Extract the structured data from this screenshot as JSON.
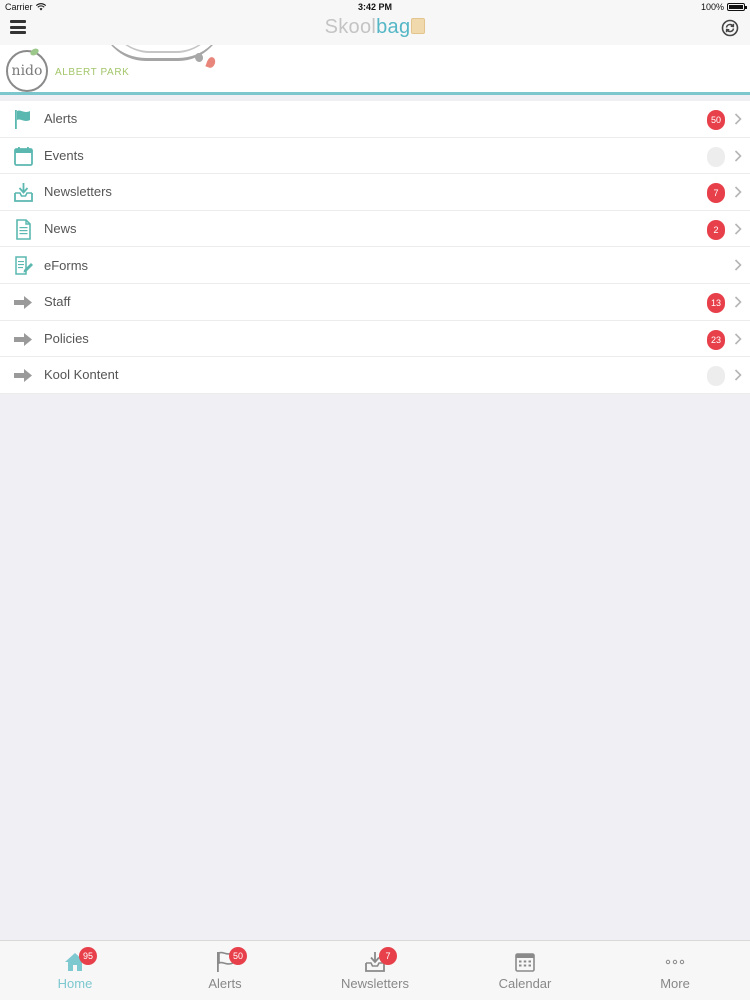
{
  "status_bar": {
    "carrier": "Carrier",
    "time": "3:42 PM",
    "battery": "100%"
  },
  "nav": {
    "brand_part1": "Skool",
    "brand_part2": "bag"
  },
  "banner": {
    "logo_text": "nido",
    "campus": "ALBERT PARK"
  },
  "menu": {
    "items": [
      {
        "label": "Alerts",
        "badge": "50",
        "icon": "flag-icon"
      },
      {
        "label": "Events",
        "badge": "",
        "icon": "calendar-icon"
      },
      {
        "label": "Newsletters",
        "badge": "7",
        "icon": "inbox-download-icon"
      },
      {
        "label": "News",
        "badge": "2",
        "icon": "document-icon"
      },
      {
        "label": "eForms",
        "badge": null,
        "icon": "form-edit-icon"
      },
      {
        "label": "Staff",
        "badge": "13",
        "icon": "arrow-right-icon"
      },
      {
        "label": "Policies",
        "badge": "23",
        "icon": "arrow-right-icon"
      },
      {
        "label": "Kool Kontent",
        "badge": "",
        "icon": "arrow-right-icon"
      }
    ]
  },
  "tabbar": {
    "tabs": [
      {
        "label": "Home",
        "badge": "95",
        "icon": "home-icon",
        "active": true
      },
      {
        "label": "Alerts",
        "badge": "50",
        "icon": "flag-icon",
        "active": false
      },
      {
        "label": "Newsletters",
        "badge": "7",
        "icon": "inbox-download-icon",
        "active": false
      },
      {
        "label": "Calendar",
        "badge": null,
        "icon": "calendar-icon",
        "active": false
      },
      {
        "label": "More",
        "badge": null,
        "icon": "more-dots-icon",
        "active": false
      }
    ]
  },
  "colors": {
    "accent": "#55b7c6",
    "badge": "#e8404a",
    "tab_active": "#7ec8d0"
  }
}
